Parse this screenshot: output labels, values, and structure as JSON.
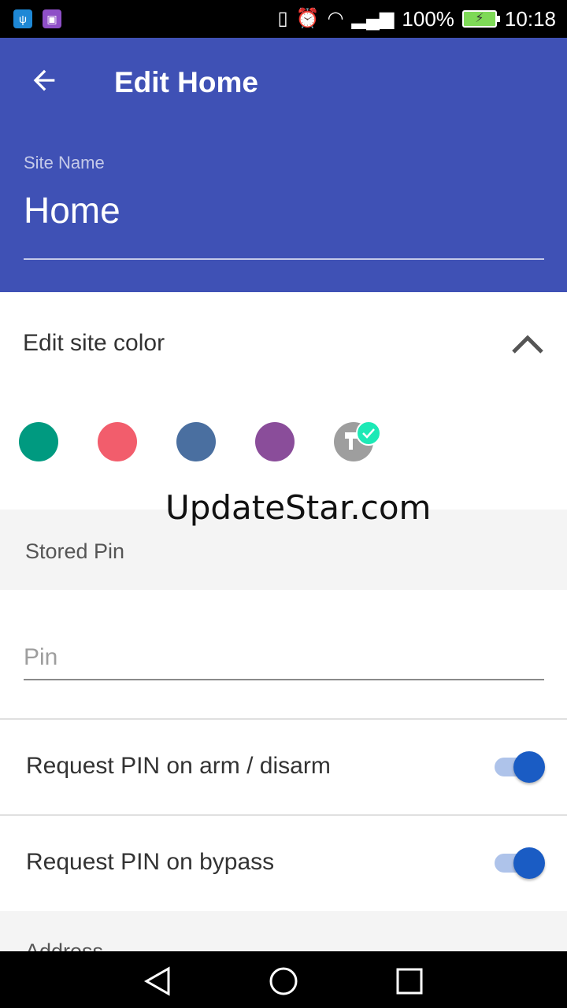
{
  "status_bar": {
    "icons": [
      "usb-icon",
      "gallery-icon",
      "vibrate-icon",
      "alarm-icon",
      "wifi-icon",
      "signal-icon"
    ],
    "battery": "100%",
    "time": "10:18"
  },
  "app_bar": {
    "title": "Edit Home",
    "back_icon": "arrow-back-icon"
  },
  "site_name": {
    "label": "Site Name",
    "value": "Home"
  },
  "color_section": {
    "label": "Edit site color",
    "expanded": true,
    "swatches": [
      "#009a80",
      "#f25d6c",
      "#4a6fa0",
      "#8a4d9a",
      "#9e9e9e"
    ],
    "selected_index": 4
  },
  "watermark": "UpdateStar.com",
  "stored_pin": {
    "section_title": "Stored Pin",
    "pin_placeholder": "Pin"
  },
  "toggles": [
    {
      "label": "Request PIN on arm / disarm",
      "on": true
    },
    {
      "label": "Request PIN on bypass",
      "on": true
    }
  ],
  "address": {
    "section_title": "Address"
  },
  "colors": {
    "primary": "#3f51b5",
    "accent": "#1a5cc4",
    "check": "#1de9b6"
  }
}
